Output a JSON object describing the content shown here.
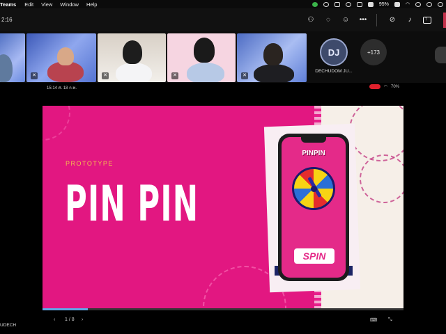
{
  "menubar": {
    "app_name": "Teams",
    "menus": [
      "Edit",
      "View",
      "Window",
      "Help"
    ],
    "battery": "95%"
  },
  "meeting": {
    "timer": "2:16",
    "toolbar": {
      "people_icon": "people-icon",
      "chat_icon": "chat-icon",
      "reactions_icon": "reactions-icon",
      "more_icon": "more-icon",
      "camera_icon": "camera-off-icon",
      "mic_icon": "mic-off-icon",
      "share_icon": "share-icon"
    }
  },
  "participants": {
    "avatar_initials": "DJ",
    "avatar_name": "DECHUDOM JU...",
    "overflow_count": "+173"
  },
  "shared_phone_status": {
    "time": "15:14",
    "date": "ศ. 18 ก.พ.",
    "battery": "70%"
  },
  "slide": {
    "label": "PROTOTYPE",
    "title": "PIN PIN",
    "app_logo": "PINPIN",
    "spin_label": "SPIN"
  },
  "presentation_controls": {
    "page_indicator": "1 / 8",
    "progress": 0.125
  },
  "presenter_name": "UDECH",
  "colors": {
    "slide_pink": "#e21781",
    "accent_yellow": "#f3c04e",
    "teams_leave_red": "#c4314b"
  }
}
